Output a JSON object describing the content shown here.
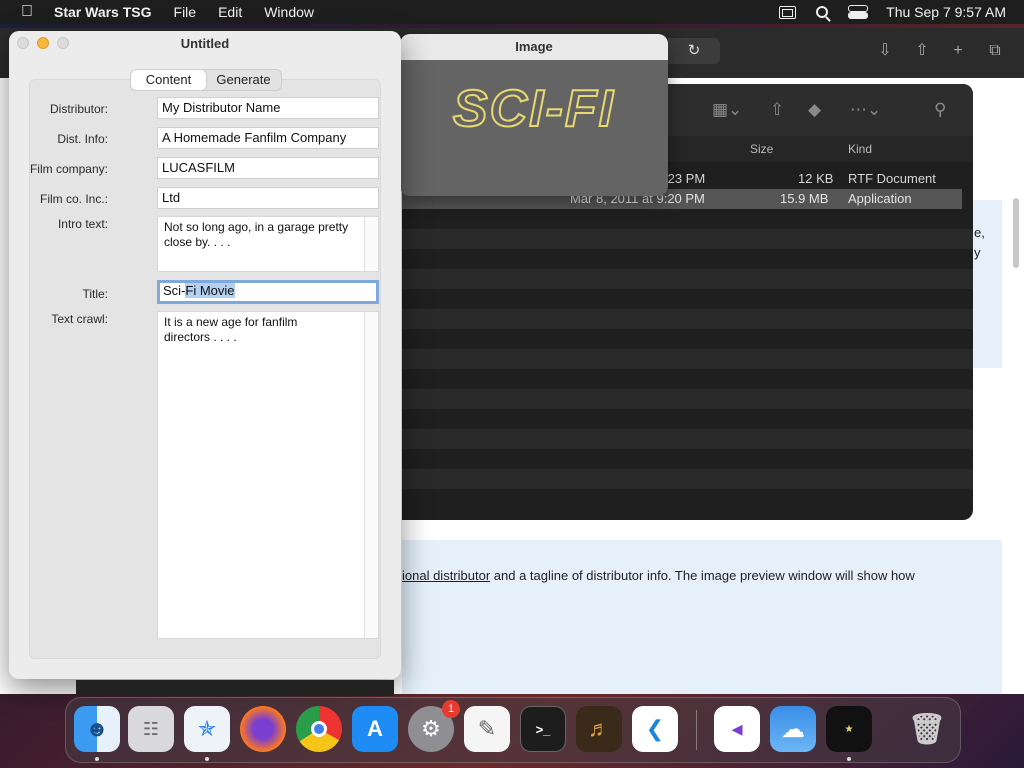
{
  "menubar": {
    "app_name": "Star Wars TSG",
    "items": [
      "File",
      "Edit",
      "Window"
    ],
    "clock": "Thu Sep 7  9:57 AM"
  },
  "browser": {
    "paragraph_link": "ional distributor",
    "paragraph_rest": " and a tagline of distributor info. The image preview window will show how",
    "edge_fragment_1": "e,",
    "edge_fragment_2": "y"
  },
  "finder": {
    "columns": {
      "size": "Size",
      "kind": "Kind"
    },
    "rows": [
      {
        "date": ":23 PM",
        "size": "12 KB",
        "kind": "RTF Document",
        "selected": false
      },
      {
        "date": "Mar 8, 2011 at 9:20 PM",
        "size": "15.9 MB",
        "kind": "Application",
        "selected": true
      }
    ]
  },
  "image_window": {
    "title": "Image",
    "logo_text": "SCI-FI",
    "logo_color": "#e8d870"
  },
  "untitled_window": {
    "title": "Untitled",
    "tabs": [
      "Content",
      "Generate"
    ],
    "active_tab": "Content",
    "fields": {
      "distributor": {
        "label": "Distributor:",
        "value": "My Distributor Name"
      },
      "dist_info": {
        "label": "Dist. Info:",
        "value": "A Homemade Fanfilm Company"
      },
      "film_company": {
        "label": "Film company:",
        "value": "LUCASFILM"
      },
      "film_co_inc": {
        "label": "Film co. Inc.:",
        "value": "Ltd"
      },
      "intro_text": {
        "label": "Intro text:",
        "value": "Not so long ago, in a garage pretty close by. . . ."
      },
      "title": {
        "label": "Title:",
        "value_pre": "Sci-",
        "value_sel": "Fi Movie"
      },
      "text_crawl": {
        "label": "Text crawl:",
        "value": "It is a new age for fanfilm directors . . . ."
      }
    }
  },
  "dock": {
    "apps": [
      "Finder",
      "Launchpad",
      "Safari",
      "Firefox",
      "Chrome",
      "App Store",
      "System Settings",
      "TextEdit",
      "Terminal",
      "GarageBand",
      "Visual Studio Code",
      "Visual Studio",
      "Weather",
      "Star Wars TSG",
      "Trash"
    ],
    "settings_badge": "1"
  }
}
